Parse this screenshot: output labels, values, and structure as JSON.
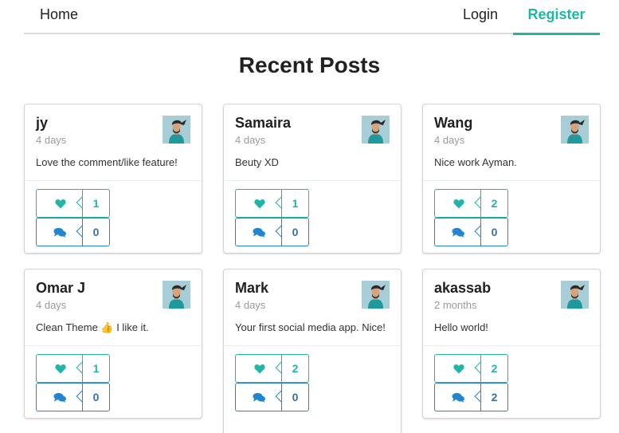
{
  "nav": {
    "home": "Home",
    "login": "Login",
    "register": "Register"
  },
  "page": {
    "title": "Recent Posts"
  },
  "posts": [
    {
      "author": "jy",
      "time": "4 days",
      "body": "Love the comment/like feature!",
      "likes": "1",
      "comments": "0"
    },
    {
      "author": "Samaira",
      "time": "4 days",
      "body": "Beuty XD",
      "likes": "1",
      "comments": "0"
    },
    {
      "author": "Wang",
      "time": "4 days",
      "body": "Nice work Ayman.",
      "likes": "2",
      "comments": "0"
    },
    {
      "author": "Omar J",
      "time": "4 days",
      "body": "Clean Theme 👍 I like it.",
      "likes": "1",
      "comments": "0"
    },
    {
      "author": "Mark",
      "time": "4 days",
      "body": "Your first social media app. Nice!",
      "likes": "2",
      "comments": "0"
    },
    {
      "author": "akassab",
      "time": "2 months",
      "body": "Hello world!",
      "likes": "2",
      "comments": "2"
    }
  ],
  "colors": {
    "accent": "#1fb6a8",
    "comment": "#2185d0"
  },
  "icons": {
    "like": "heart-icon",
    "comment": "comments-icon"
  }
}
